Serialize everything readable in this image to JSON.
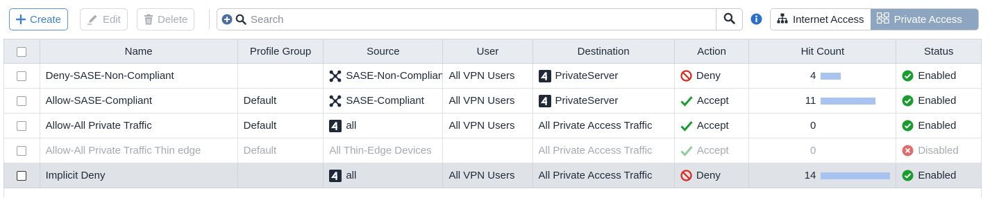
{
  "toolbar": {
    "create_label": "Create",
    "edit_label": "Edit",
    "delete_label": "Delete",
    "search_placeholder": "Search",
    "access_options": [
      "Internet Access",
      "Private Access"
    ],
    "active_access": "Private Access"
  },
  "colors": {
    "accent": "#3f7fd0",
    "active_segment": "#8ea5c2",
    "deny": "#d9281e",
    "accept": "#1a9c2e",
    "enabled": "#1a9c2e",
    "disabled": "#e06c6c",
    "hit_bar": "#a8c3f0"
  },
  "table": {
    "headers": [
      "Name",
      "Profile Group",
      "Source",
      "User",
      "Destination",
      "Action",
      "Hit Count",
      "Status"
    ],
    "hit_max": 14,
    "rows": [
      {
        "name": "Deny-SASE-Non-Compliant",
        "profile_group": "",
        "source": "SASE-Non-Compliant",
        "source_icon": "cluster-icon",
        "user": "All VPN Users",
        "destination": "PrivateServer",
        "destination_icon": "object-icon",
        "action": "Deny",
        "hit_count": 4,
        "status": "Enabled"
      },
      {
        "name": "Allow-SASE-Compliant",
        "profile_group": "Default",
        "source": "SASE-Compliant",
        "source_icon": "cluster-icon",
        "user": "All VPN Users",
        "destination": "PrivateServer",
        "destination_icon": "object-icon",
        "action": "Accept",
        "hit_count": 11,
        "status": "Enabled"
      },
      {
        "name": "Allow-All Private Traffic",
        "profile_group": "Default",
        "source": "all",
        "source_icon": "object-icon",
        "user": "All VPN Users",
        "destination": "All Private Access Traffic",
        "destination_icon": "",
        "action": "Accept",
        "hit_count": 0,
        "status": "Enabled"
      },
      {
        "name": "Allow-All Private Traffic Thin edge",
        "profile_group": "Default",
        "source": "All Thin-Edge Devices",
        "source_icon": "",
        "user": "",
        "destination": "All Private Access Traffic",
        "destination_icon": "",
        "action": "Accept",
        "hit_count": 0,
        "status": "Disabled"
      },
      {
        "name": "Implicit Deny",
        "profile_group": "",
        "source": "all",
        "source_icon": "object-icon",
        "user": "All VPN Users",
        "destination": "All Private Access Traffic",
        "destination_icon": "",
        "action": "Deny",
        "hit_count": 14,
        "status": "Enabled"
      }
    ]
  }
}
